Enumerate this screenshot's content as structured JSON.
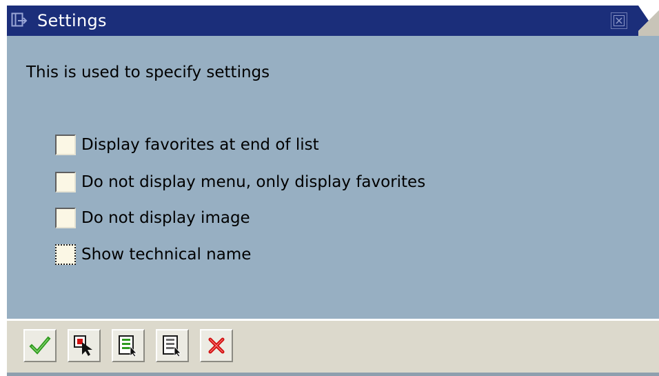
{
  "window": {
    "title": "Settings"
  },
  "content": {
    "description": "This is used to specify settings",
    "options": [
      {
        "label": "Display favorites at end of list",
        "checked": false,
        "focused": false
      },
      {
        "label": "Do not display menu, only display favorites",
        "checked": false,
        "focused": false
      },
      {
        "label": "Do not display image",
        "checked": false,
        "focused": false
      },
      {
        "label": "Show technical name",
        "checked": false,
        "focused": true
      }
    ]
  },
  "toolbar": {
    "buttons": [
      {
        "name": "confirm",
        "icon": "checkmark-icon"
      },
      {
        "name": "select",
        "icon": "select-cursor-icon"
      },
      {
        "name": "select-all",
        "icon": "select-all-icon"
      },
      {
        "name": "deselect-all",
        "icon": "deselect-all-icon"
      },
      {
        "name": "cancel",
        "icon": "cancel-x-icon"
      }
    ]
  },
  "colors": {
    "titlebar": "#1b2e7a",
    "content_bg": "#97afc2",
    "toolbar_bg": "#dcd9cc",
    "checkbox_bg": "#fbf7e5",
    "confirm_green": "#2e9a1e",
    "cancel_red": "#d01010"
  }
}
